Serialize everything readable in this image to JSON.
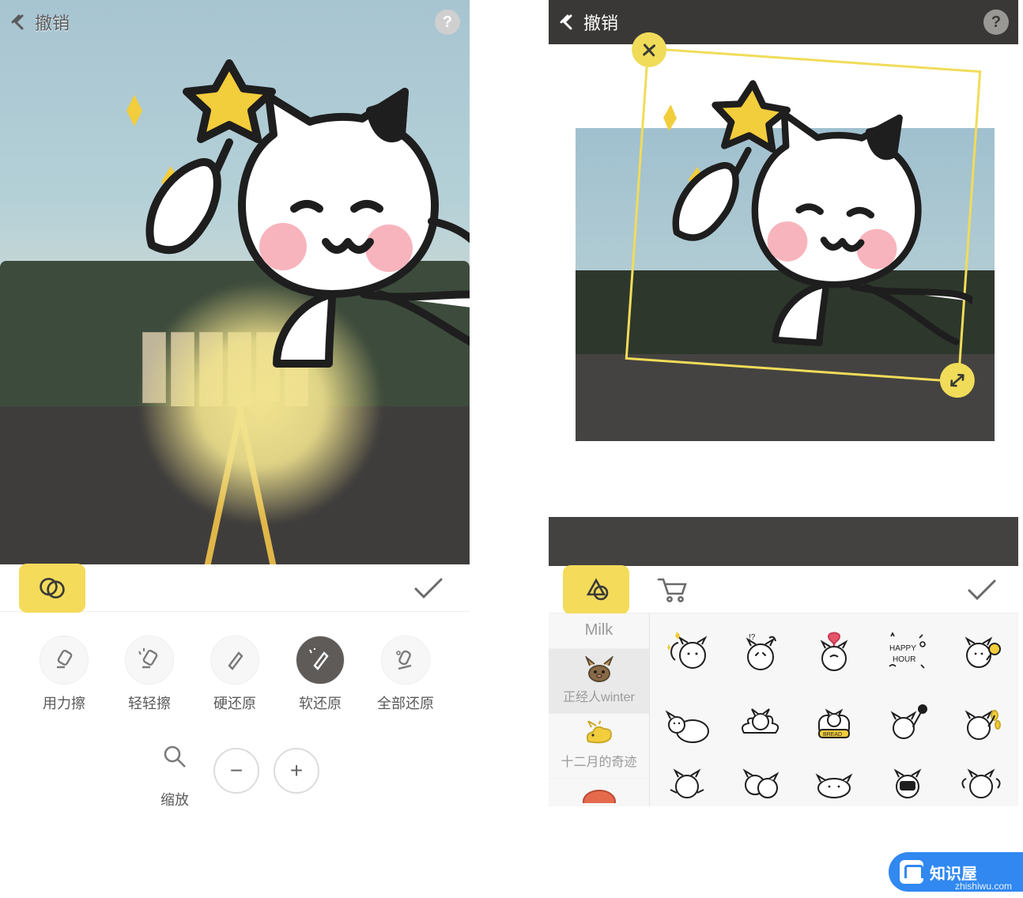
{
  "left": {
    "undo_label": "撤销",
    "tools": {
      "hard_erase": "用力擦",
      "soft_erase": "轻轻擦",
      "hard_restore": "硬还原",
      "soft_restore": "软还原",
      "restore_all": "全部还原",
      "zoom": "缩放"
    }
  },
  "right": {
    "undo_label": "撤销",
    "packs": {
      "milk": "Milk",
      "zjr": "正经人winter",
      "december": "十二月的奇迹"
    }
  },
  "watermark": {
    "name": "知识屋",
    "url": "zhishiwu.com"
  }
}
